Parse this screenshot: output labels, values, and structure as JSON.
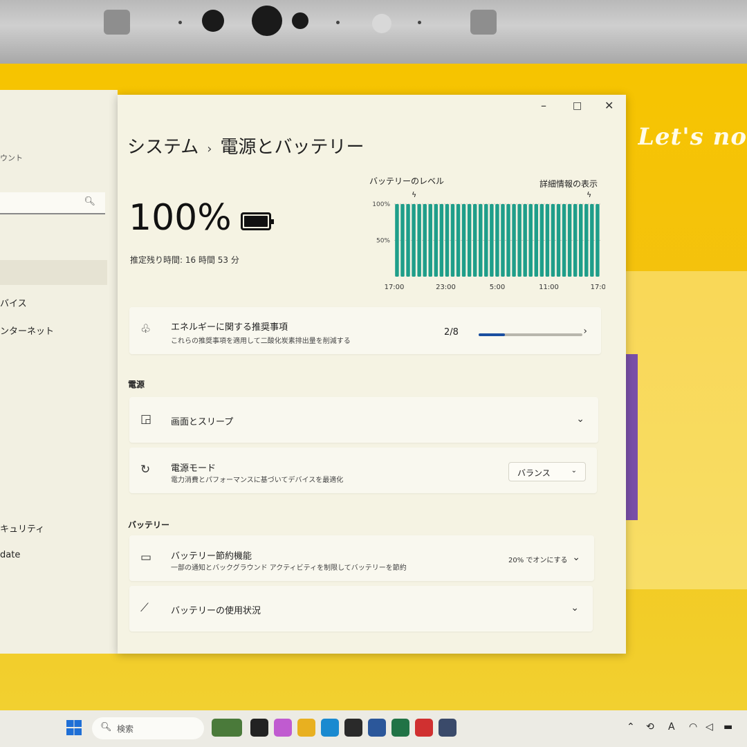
{
  "brand": "Let's no",
  "sidebar": {
    "account_fragment": "ウント",
    "search_icon": "search-icon",
    "items": [
      {
        "label": "バイス"
      },
      {
        "label": "ンターネット"
      },
      {
        "label": "キュリティ"
      },
      {
        "label": "date"
      }
    ]
  },
  "window": {
    "controls": {
      "minimize": "–",
      "maximize": "□",
      "close": "✕"
    },
    "breadcrumb": {
      "parent": "システム",
      "separator": "›",
      "current": "電源とバッテリー"
    },
    "battery": {
      "percent_text": "100%",
      "remaining_label": "推定残り時間:",
      "remaining_value": "16 時間 53 分"
    },
    "chart_link": "詳細情報の表示"
  },
  "chart_data": {
    "type": "bar",
    "title": "バッテリーのレベル",
    "y_ticks": [
      "100%",
      "50%"
    ],
    "x_ticks": [
      "17:00",
      "23:00",
      "5:00",
      "11:00",
      "17:00"
    ],
    "ylim": [
      0,
      100
    ],
    "bar_color": "#1f9e8a",
    "values": [
      100,
      100,
      100,
      100,
      100,
      100,
      100,
      100,
      100,
      100,
      100,
      100,
      100,
      100,
      100,
      100,
      100,
      100,
      100,
      100,
      100,
      100,
      100,
      100,
      100,
      100,
      100,
      100,
      100,
      100,
      100,
      100,
      100,
      100,
      100,
      100,
      100
    ]
  },
  "energy_card": {
    "title": "エネルギーに関する推奨事項",
    "subtitle": "これらの推奨事項を適用して二酸化炭素排出量を削減する",
    "count": "2/8",
    "progress": 0.25
  },
  "power_section": {
    "heading": "電源",
    "screen_sleep": {
      "title": "画面とスリープ"
    },
    "power_mode": {
      "title": "電源モード",
      "subtitle": "電力消費とパフォーマンスに基づいてデバイスを最適化",
      "value": "バランス"
    }
  },
  "battery_section": {
    "heading": "バッテリー",
    "saver": {
      "title": "バッテリー節約機能",
      "subtitle": "一部の通知とバックグラウンド アクティビティを制限してバッテリーを節約",
      "value": "20% でオンにする"
    },
    "usage": {
      "title": "バッテリーの使用状況"
    }
  },
  "taskbar": {
    "search_placeholder": "検索",
    "apps": [
      {
        "name": "widgets",
        "color": "#4a7a3a"
      },
      {
        "name": "task-view",
        "color": "#222222"
      },
      {
        "name": "copilot",
        "color": "#c05bd0"
      },
      {
        "name": "file-explorer",
        "color": "#e8b020"
      },
      {
        "name": "edge",
        "color": "#1a8ad0"
      },
      {
        "name": "store",
        "color": "#2a2a2a"
      },
      {
        "name": "word",
        "color": "#2b579a"
      },
      {
        "name": "excel",
        "color": "#217346"
      },
      {
        "name": "office",
        "color": "#d03030"
      },
      {
        "name": "settings",
        "color": "#3a4a6a"
      }
    ],
    "tray_letter": "A"
  }
}
